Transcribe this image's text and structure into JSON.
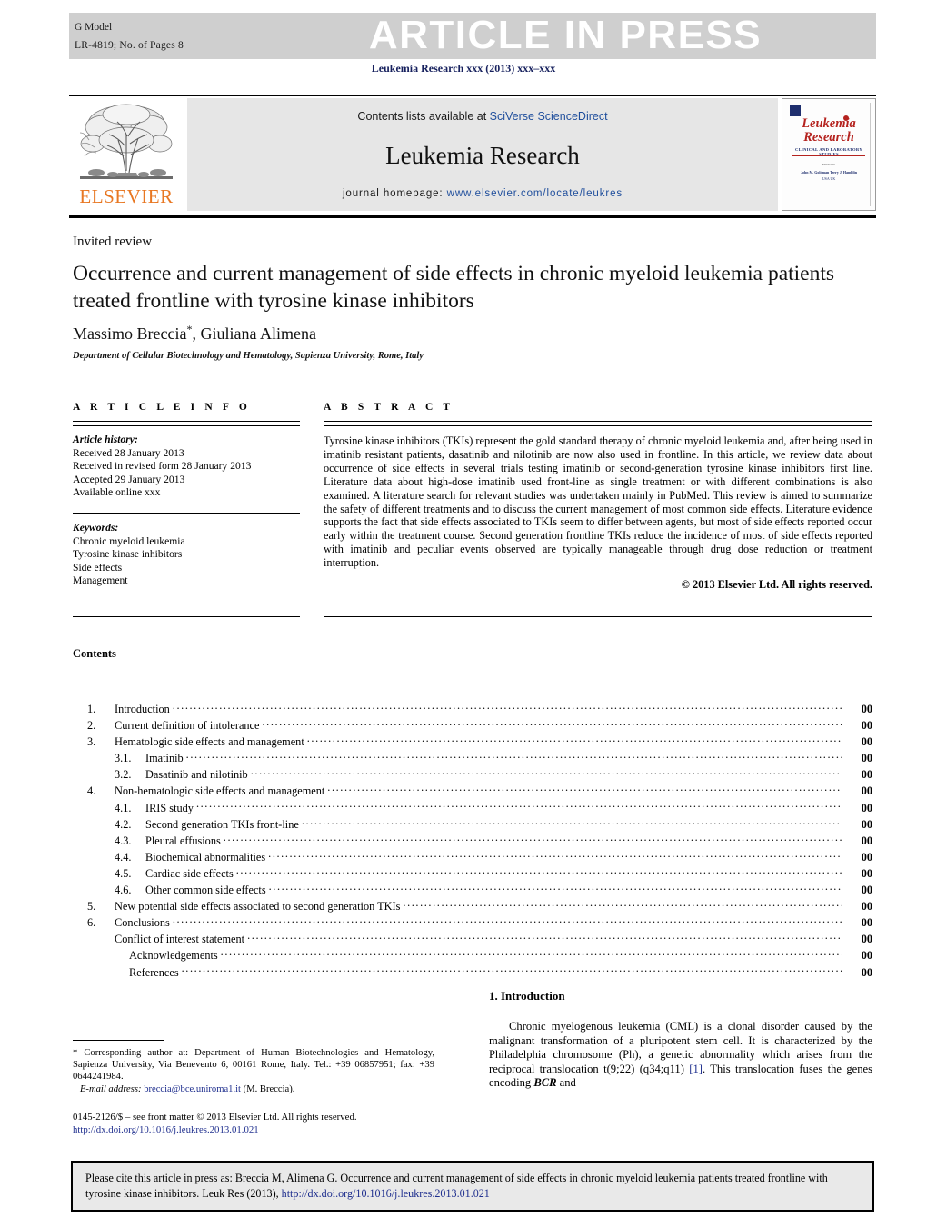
{
  "header": {
    "g_model": "G Model",
    "article_id": "LR-4819;   No. of Pages 8",
    "banner_text": "ARTICLE IN PRESS",
    "journal_ref": "Leukemia Research xxx (2013) xxx–xxx"
  },
  "masthead": {
    "contents_prefix": "Contents lists available at ",
    "contents_link": "SciVerse ScienceDirect",
    "journal_title": "Leukemia Research",
    "homepage_prefix": "journal homepage: ",
    "homepage_url": "www.elsevier.com/locate/leukres",
    "publisher": "ELSEVIER",
    "cover": {
      "title_line1": "Leukemia",
      "title_line2": "Research",
      "subtitle": "CLINICAL AND LABORATORY STUDIES",
      "small_line1": "EDITORS",
      "small_line2": "John M. Goldman          Terry J. Hamblin",
      "small_line3": "USA                              UK"
    }
  },
  "article": {
    "type": "Invited review",
    "title": "Occurrence and current management of side effects in chronic myeloid leukemia patients treated frontline with tyrosine kinase inhibitors",
    "authors": "Massimo Breccia",
    "authors_star": "*",
    "authors_rest": ", Giuliana Alimena",
    "affiliation": "Department of Cellular Biotechnology and Hematology, Sapienza University, Rome, Italy"
  },
  "article_info": {
    "heading": "A R T I C L E   I N F O",
    "history_label": "Article history:",
    "history": [
      "Received 28 January 2013",
      "Received in revised form 28 January 2013",
      "Accepted 29 January 2013",
      "Available online xxx"
    ],
    "keywords_label": "Keywords:",
    "keywords": [
      "Chronic myeloid leukemia",
      "Tyrosine kinase inhibitors",
      "Side effects",
      "Management"
    ]
  },
  "abstract": {
    "heading": "A B S T R A C T",
    "body": "Tyrosine kinase inhibitors (TKIs) represent the gold standard therapy of chronic myeloid leukemia and, after being used in imatinib resistant patients, dasatinib and nilotinib are now also used in frontline. In this article, we review data about occurrence of side effects in several trials testing imatinib or second-generation tyrosine kinase inhibitors first line. Literature data about high-dose imatinib used front-line as single treatment or with different combinations is also examined. A literature search for relevant studies was undertaken mainly in PubMed. This review is aimed to summarize the safety of different treatments and to discuss the current management of most common side effects. Literature evidence supports the fact that side effects associated to TKIs seem to differ between agents, but most of side effects reported occur early within the treatment course. Second generation frontline TKIs reduce the incidence of most of side effects reported with imatinib and peculiar events observed are typically manageable through drug dose reduction or treatment interruption.",
    "copyright": "© 2013 Elsevier Ltd. All rights reserved."
  },
  "contents": {
    "heading": "Contents",
    "entries": [
      {
        "num": "1.",
        "label": "Introduction",
        "page": "00",
        "level": 1
      },
      {
        "num": "2.",
        "label": "Current definition of intolerance",
        "page": "00",
        "level": 1
      },
      {
        "num": "3.",
        "label": "Hematologic side effects and management",
        "page": "00",
        "level": 1
      },
      {
        "num": "3.1.",
        "label": "Imatinib",
        "page": "00",
        "level": 2
      },
      {
        "num": "3.2.",
        "label": "Dasatinib and nilotinib",
        "page": "00",
        "level": 2
      },
      {
        "num": "4.",
        "label": "Non-hematologic side effects and management",
        "page": "00",
        "level": 1
      },
      {
        "num": "4.1.",
        "label": "IRIS study",
        "page": "00",
        "level": 2
      },
      {
        "num": "4.2.",
        "label": "Second generation TKIs front-line",
        "page": "00",
        "level": 2
      },
      {
        "num": "4.3.",
        "label": "Pleural effusions",
        "page": "00",
        "level": 2
      },
      {
        "num": "4.4.",
        "label": "Biochemical abnormalities",
        "page": "00",
        "level": 2
      },
      {
        "num": "4.5.",
        "label": "Cardiac side effects",
        "page": "00",
        "level": 2
      },
      {
        "num": "4.6.",
        "label": "Other common side effects",
        "page": "00",
        "level": 2
      },
      {
        "num": "5.",
        "label": "New potential side effects associated to second generation TKIs",
        "page": "00",
        "level": 1
      },
      {
        "num": "6.",
        "label": "Conclusions",
        "page": "00",
        "level": 1
      },
      {
        "num": "",
        "label": "Conflict of interest statement",
        "page": "00",
        "level": 1.5
      },
      {
        "num": "",
        "label": "Acknowledgements",
        "page": "00",
        "level": 2.5
      },
      {
        "num": "",
        "label": "References",
        "page": "00",
        "level": 2.5
      }
    ]
  },
  "footnote": {
    "star": "*",
    "corresponding": " Corresponding author at: Department of Human Biotechnologies and Hematology, Sapienza University, Via Benevento 6, 00161 Rome, Italy. Tel.: +39 06857951; fax: +39 0644241984.",
    "email_label": "E-mail address:",
    "email": "breccia@bce.uniroma1.it",
    "email_suffix": " (M. Breccia)."
  },
  "frontmatter": {
    "issn_line": "0145-2126/$ – see front matter © 2013 Elsevier Ltd. All rights reserved.",
    "doi": "http://dx.doi.org/10.1016/j.leukres.2013.01.021"
  },
  "introduction": {
    "heading": "1.  Introduction",
    "para_start": "Chronic myelogenous leukemia (CML) is a clonal disorder caused by the malignant transformation of a pluripotent stem cell. It is characterized by the Philadelphia chromosome (Ph), a genetic abnormality which arises from the reciprocal translocation t(9;22) (q34;q11) ",
    "ref": "[1]",
    "para_mid": ". This translocation fuses the genes encoding ",
    "gene": "BCR",
    "para_end": " and"
  },
  "cite_box": {
    "text_start": "Please cite this article in press as: Breccia M, Alimena G. Occurrence and current management of side effects in chronic myeloid leukemia patients treated frontline with tyrosine kinase inhibitors. Leuk Res (2013), ",
    "link": "http://dx.doi.org/10.1016/j.leukres.2013.01.021"
  },
  "colors": {
    "banner_bg": "#cfcfcf",
    "banner_text": "#ffffff",
    "journal_ref": "#17215e",
    "link_blue": "#1f4e9c",
    "elsevier_orange": "#E87722",
    "cover_red": "#b5231f",
    "masthead_bg": "#e6e6e6"
  }
}
